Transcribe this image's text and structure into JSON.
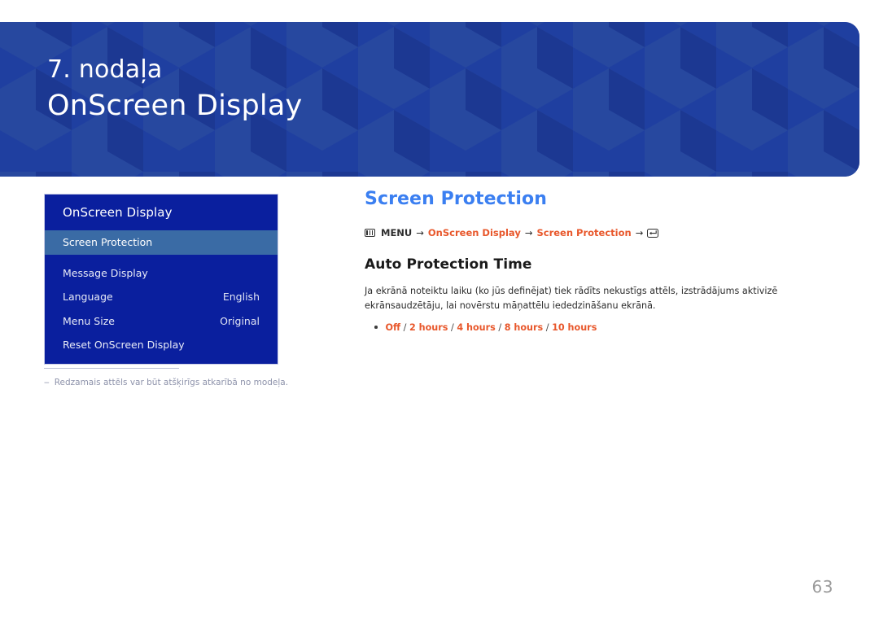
{
  "banner": {
    "chapter_number": "7. nodaļa",
    "chapter_title": "OnScreen Display",
    "bg_color": "#1f3fa0"
  },
  "osd_menu": {
    "header": "OnScreen Display",
    "rows": [
      {
        "label": "Screen Protection",
        "value": "",
        "selected": true
      },
      {
        "label": "Message Display",
        "value": "",
        "selected": false
      },
      {
        "label": "Language",
        "value": "English",
        "selected": false
      },
      {
        "label": "Menu Size",
        "value": "Original",
        "selected": false
      },
      {
        "label": "Reset OnScreen Display",
        "value": "",
        "selected": false
      }
    ],
    "bg_color": "#0a1f9e",
    "selected_color": "#3a6ba5"
  },
  "footnote": {
    "dash": "‒",
    "text": "Redzamais attēls var būt atšķirīgs atkarībā no modeļa."
  },
  "content": {
    "page_heading": "Screen Protection",
    "heading_color": "#3b7ff1",
    "breadcrumb": {
      "menu_icon": "menu-grid-icon",
      "menu_label": "MENU",
      "arrow": "→",
      "step1": "OnScreen Display",
      "step2": "Screen Protection",
      "enter_icon": "enter-key-icon",
      "accent_color": "#e8572b"
    },
    "sub_heading": "Auto Protection Time",
    "body_text": "Ja ekrānā noteiktu laiku (ko jūs definējat) tiek rādīts nekustīgs attēls, izstrādājums aktivizē ekrānsaudzētāju, lai novērstu māņattēlu iededzināšanu ekrānā.",
    "options": {
      "values": [
        "Off",
        "2 hours",
        "4 hours",
        "8 hours",
        "10 hours"
      ],
      "separator": "/"
    }
  },
  "page_number": "63"
}
